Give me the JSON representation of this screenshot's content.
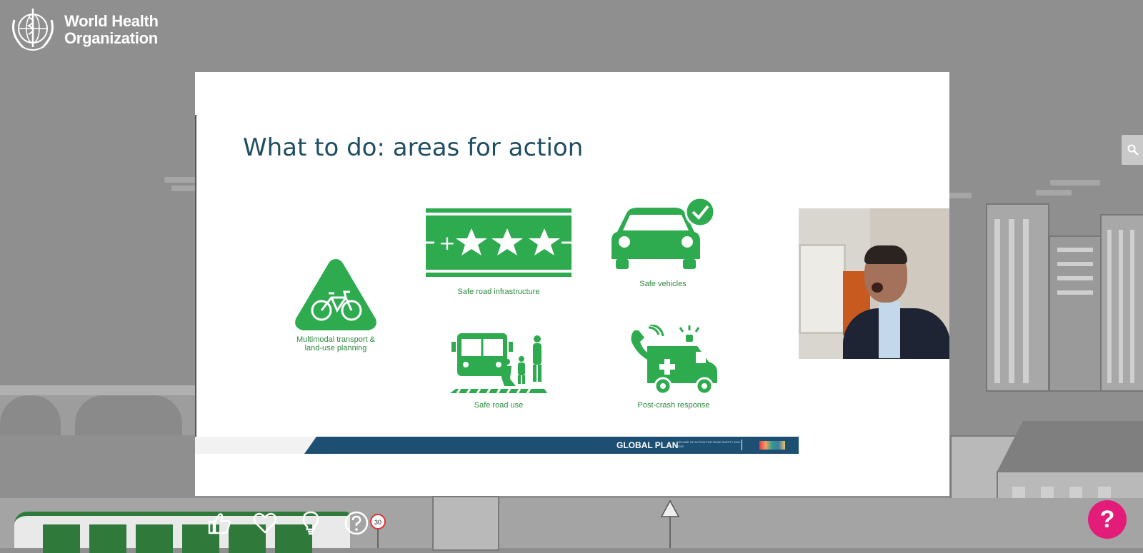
{
  "logo": {
    "line1": "World Health",
    "line2": "Organization"
  },
  "slide": {
    "title": "What to do: areas for action",
    "areas": [
      {
        "label": "Multimodal transport &"
      },
      {
        "label": "land-use planning"
      },
      {
        "label": "Safe road infrastructure"
      },
      {
        "label": "Safe vehicles"
      },
      {
        "label": "Safe road use"
      },
      {
        "label": "Post-crash response"
      }
    ],
    "footer": {
      "brand": "GLOBAL PLAN",
      "subtitle": "DECADE OF ACTION FOR ROAD SAFETY 2021-2030",
      "badge": "ROAD SAFETY"
    }
  },
  "video": {
    "participant": "speaker-video"
  },
  "scene": {
    "speed_sign": "30"
  },
  "colors": {
    "accent": "#2eaa4f",
    "title": "#1f4e63",
    "footer": "#1c4f72",
    "help": "#e31c79",
    "background": "#8f8f8f"
  },
  "icons": {
    "search": "search-icon",
    "like": "thumbs-up-icon",
    "love": "heart-icon",
    "idea": "lightbulb-icon",
    "question": "question-icon",
    "help": "help-icon"
  },
  "help_button": {
    "label": "?"
  }
}
